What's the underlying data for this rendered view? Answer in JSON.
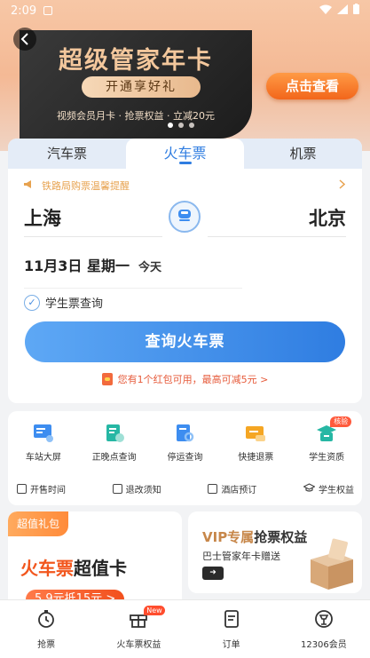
{
  "status_bar": {
    "time": "2:09"
  },
  "banner": {
    "title": "超级管家年卡",
    "pill": "开通享好礼",
    "subtitle": "视频会员月卡 · 抢票权益 · 立减20元",
    "cta": "点击查看"
  },
  "tabs": [
    {
      "label": "汽车票"
    },
    {
      "label": "火车票"
    },
    {
      "label": "机票"
    }
  ],
  "booking": {
    "notice": "铁路局购票温馨提醒",
    "from_city": "上海",
    "to_city": "北京",
    "date": "11月3日  星期一",
    "date_note": "今天",
    "student_label": "学生票查询",
    "search_button": "查询火车票",
    "redpack_text": "您有1个红包可用，最高可减5元 >"
  },
  "services": {
    "items": [
      {
        "label": "车站大屏",
        "icon": "screen-icon",
        "color": "#3d8df0"
      },
      {
        "label": "正晚点查询",
        "icon": "clock-doc-icon",
        "color": "#26b7a4"
      },
      {
        "label": "停运查询",
        "icon": "search-doc-icon",
        "color": "#3d8df0"
      },
      {
        "label": "快捷退票",
        "icon": "ticket-icon",
        "color": "#f5a623"
      },
      {
        "label": "学生资质",
        "icon": "student-icon",
        "color": "#26b7a4",
        "badge": "核验"
      }
    ],
    "links": [
      {
        "label": "开售时间"
      },
      {
        "label": "退改须知"
      },
      {
        "label": "酒店预订"
      },
      {
        "label": "学生权益"
      }
    ]
  },
  "promo_left": {
    "tag": "超值礼包",
    "title_red": "火车票",
    "title_black": "超值卡",
    "pill": "5.9元抵15元 >"
  },
  "promo_right": {
    "title_gold": "VIP专属",
    "title_black": "抢票权益",
    "subtitle": "巴士管家年卡赠送",
    "button": "➜"
  },
  "tabbar": [
    {
      "label": "抢票",
      "icon": "stopwatch-icon"
    },
    {
      "label": "火车票权益",
      "icon": "gift-icon",
      "badge": "New"
    },
    {
      "label": "订单",
      "icon": "order-icon"
    },
    {
      "label": "12306会员",
      "icon": "train-member-icon"
    }
  ],
  "colors": {
    "accent": "#2f7de1",
    "orange": "#f2661b",
    "gold": "#f3c79c"
  }
}
